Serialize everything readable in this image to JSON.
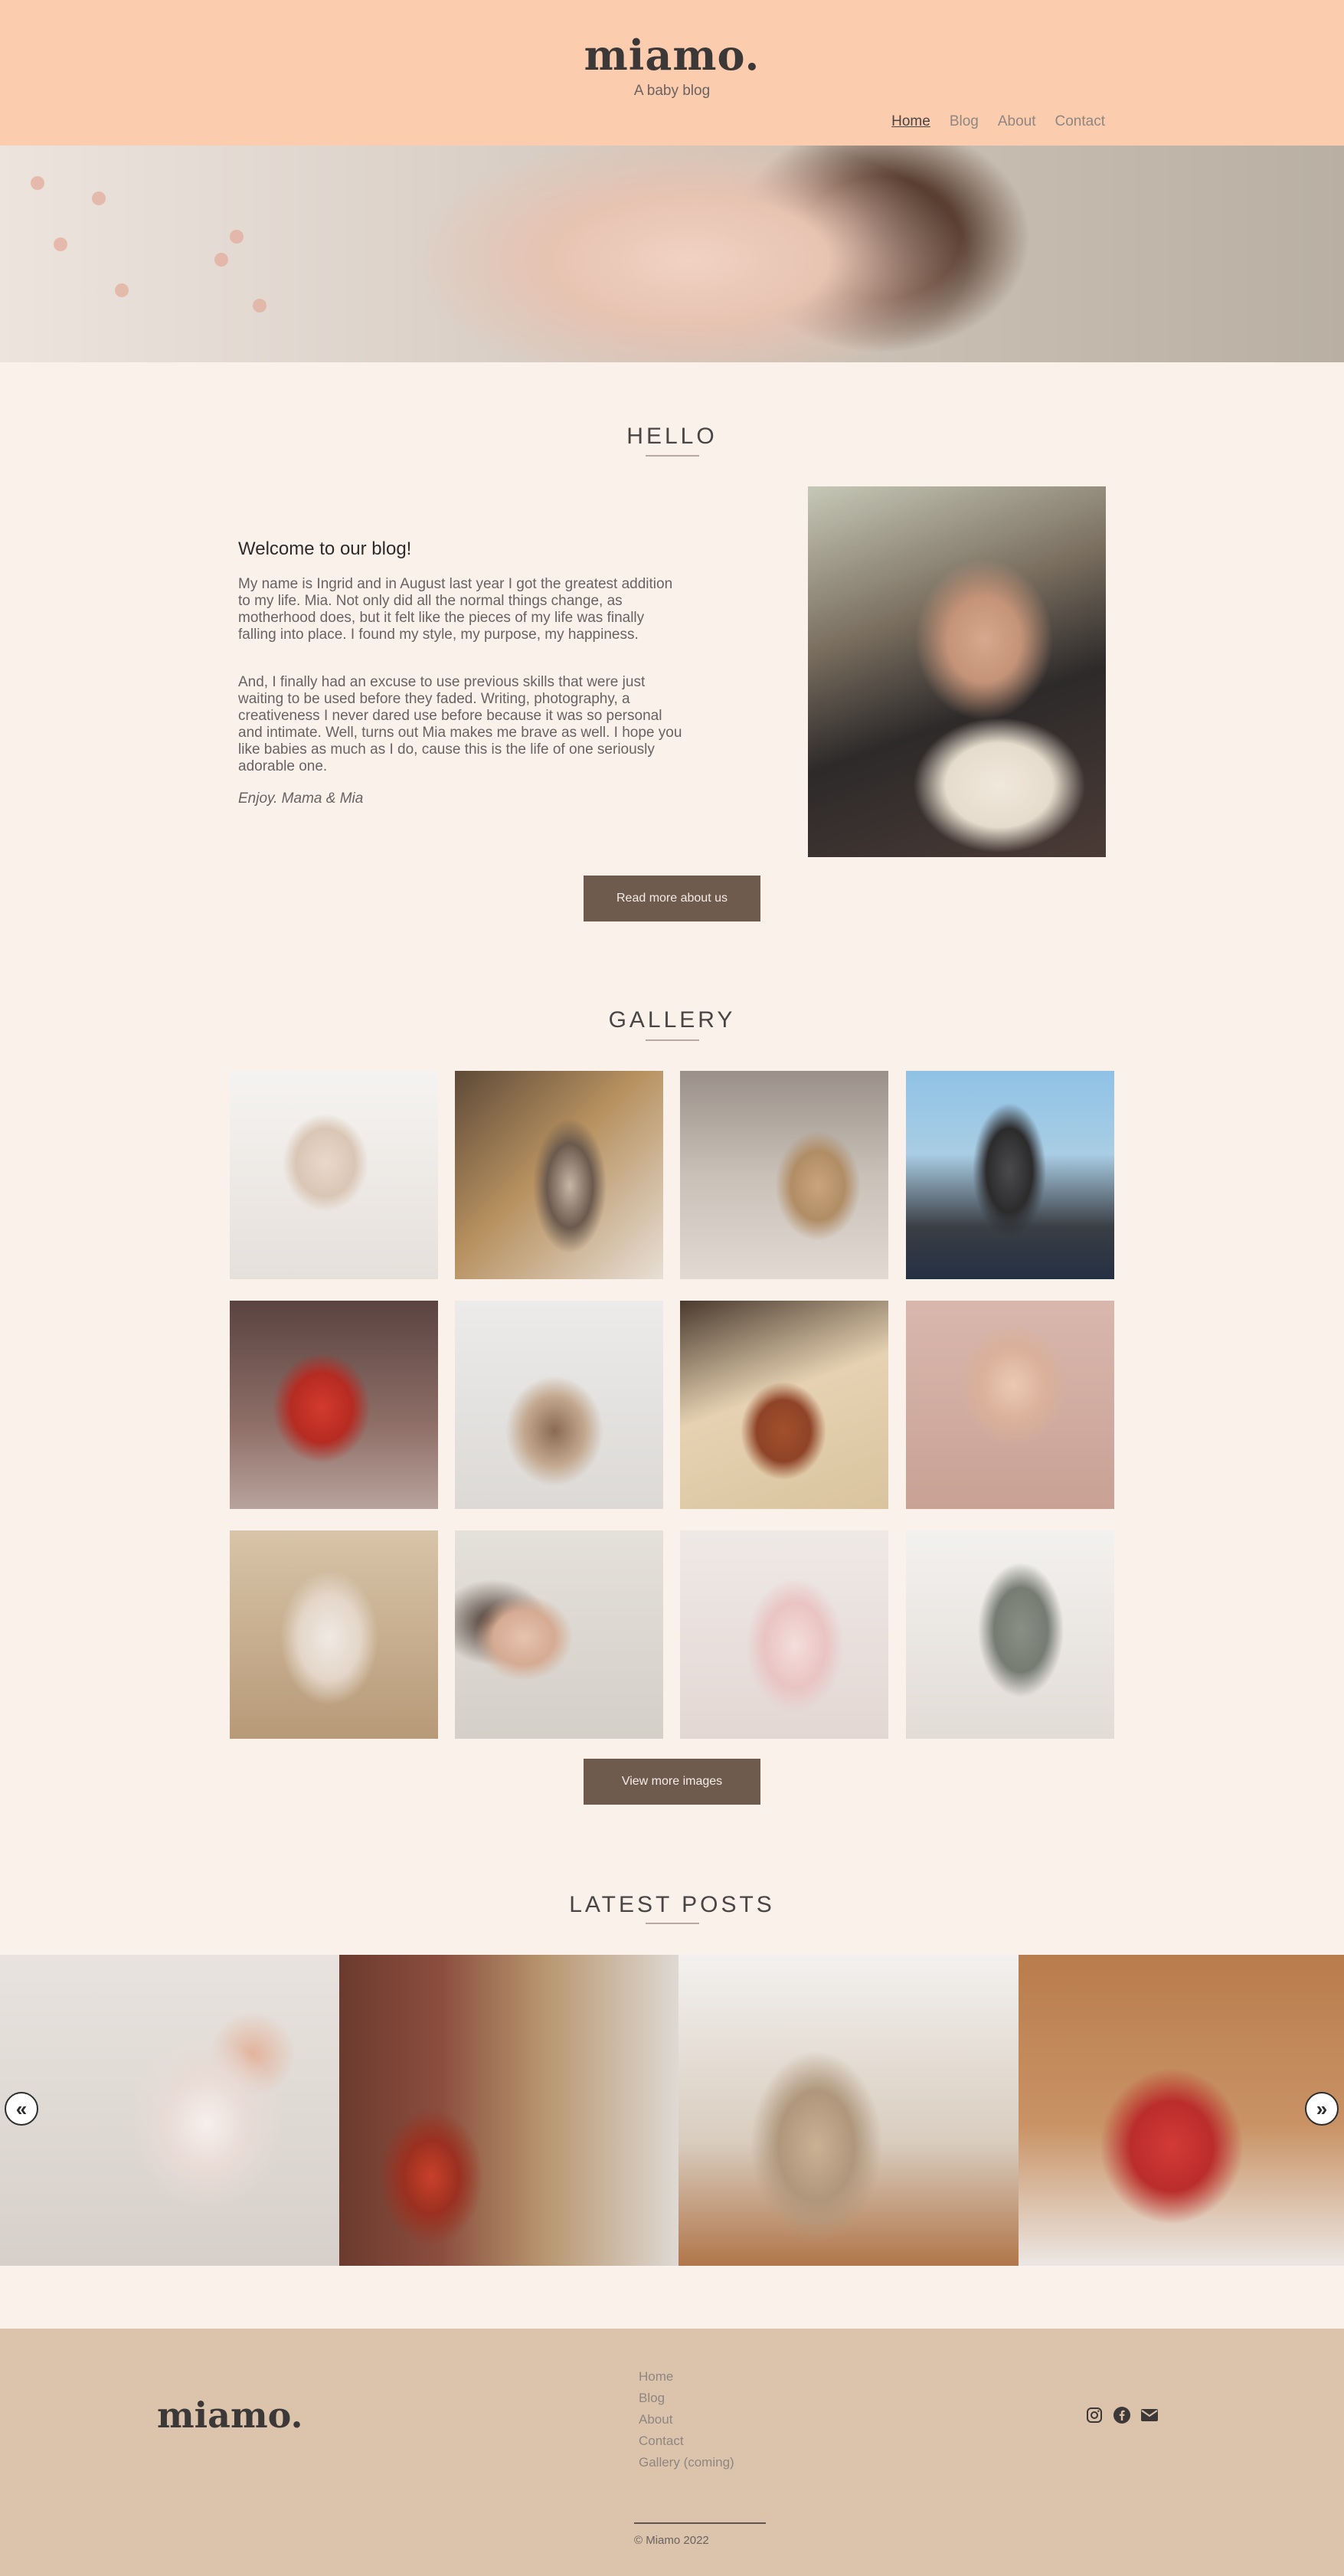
{
  "header": {
    "logo": "miamo.",
    "tagline": "A baby blog",
    "nav": [
      "Home",
      "Blog",
      "About",
      "Contact"
    ]
  },
  "hello": {
    "title": "HELLO",
    "heading": "Welcome to our blog!",
    "paragraphs": [
      "My name is Ingrid and in August last year I got the greatest addition to my life. Mia. Not only did all the normal things change, as motherhood does, but it felt like the pieces of my life was finally falling into place. I found my style, my purpose, my happiness.",
      "And, I finally had an excuse to use previous skills that were just waiting to be used before they faded. Writing, photography, a creativeness I never dared use before because it was so personal and intimate. Well, turns out Mia makes me brave as well. I hope you like babies as much as I do, cause this is the life of one seriously adorable one."
    ],
    "signoff": "Enjoy. Mama & Mia",
    "button": "Read more about us"
  },
  "gallery": {
    "title": "GALLERY",
    "button": "View more images"
  },
  "posts": {
    "title": "LATEST POSTS",
    "prev": "«",
    "next": "»"
  },
  "footer": {
    "logo": "miamo.",
    "links": [
      "Home",
      "Blog",
      "About",
      "Contact",
      "Gallery (coming)"
    ],
    "social_icons": [
      "instagram-icon",
      "facebook-icon",
      "envelope-icon"
    ],
    "copyright": "© Miamo 2022"
  },
  "colors": {
    "header_bg": "#fbcdae",
    "page_bg": "#f9f1ea",
    "button_bg": "#6f5b4e",
    "footer_bg": "#dbc4ab"
  }
}
